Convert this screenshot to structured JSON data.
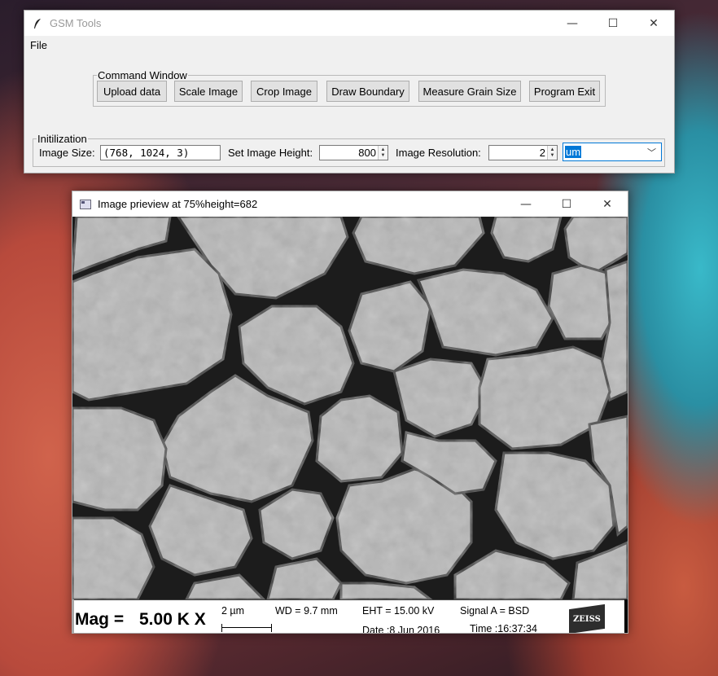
{
  "main_window": {
    "title": "GSM Tools",
    "controls": {
      "minimize": "—",
      "maximize": "☐",
      "close": "✕"
    },
    "menu": {
      "file": "File"
    },
    "command_window": {
      "legend": "Command Window",
      "buttons": {
        "upload": "Upload data",
        "scale": "Scale Image",
        "crop": "Crop Image",
        "draw_boundary": "Draw Boundary",
        "measure": "Measure Grain Size",
        "exit": "Program Exit"
      }
    },
    "initialization": {
      "legend": "Initilization",
      "image_size_label": "Image Size:",
      "image_size_value": "(768, 1024, 3)",
      "set_height_label": "Set Image Height:",
      "set_height_value": "800",
      "resolution_label": "Image Resolution:",
      "resolution_value": "2",
      "unit_selected": "um"
    }
  },
  "preview_window": {
    "title": "Image prieview at 75%height=682",
    "controls": {
      "minimize": "—",
      "maximize": "☐",
      "close": "✕"
    },
    "info_bar": {
      "mag_label": "Mag =",
      "mag_value": "5.00 K X",
      "scale_label": "2 µm",
      "wd": "WD =  9.7 mm",
      "eht": "EHT = 15.00 kV",
      "signal": "Signal A = BSD",
      "date": "Date :8 Jun 2016",
      "time": "Time :16:37:34",
      "logo_text": "ZEISS"
    }
  }
}
